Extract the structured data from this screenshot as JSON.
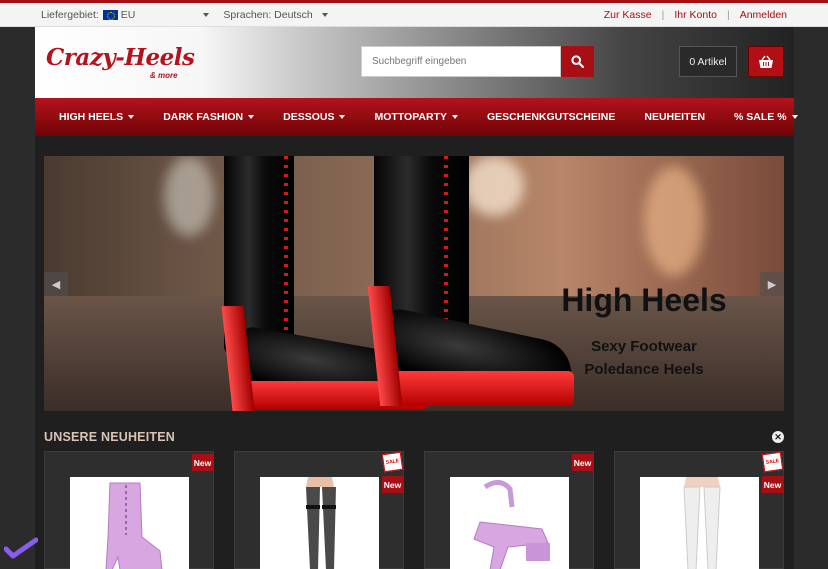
{
  "topbar": {
    "delivery_label": "Liefergebiet:",
    "delivery_value": "EU",
    "language_label": "Sprachen: Deutsch",
    "links": [
      "Zur Kasse",
      "Ihr Konto",
      "Anmelden"
    ]
  },
  "header": {
    "logo_text": "Crazy-Heels",
    "logo_sub": "& more",
    "search_placeholder": "Suchbegriff eingeben",
    "cart_count": "0 Artikel"
  },
  "nav": {
    "items": [
      {
        "label": "HIGH HEELS",
        "dropdown": true
      },
      {
        "label": "DARK FASHION",
        "dropdown": true
      },
      {
        "label": "DESSOUS",
        "dropdown": true
      },
      {
        "label": "MOTTOPARTY",
        "dropdown": true
      },
      {
        "label": "GESCHENKGUTSCHEINE",
        "dropdown": false
      },
      {
        "label": "NEUHEITEN",
        "dropdown": false
      },
      {
        "label": "% SALE %",
        "dropdown": true
      }
    ]
  },
  "slider": {
    "title": "High Heels",
    "subtitle1": "Sexy Footwear",
    "subtitle2": "Poledance Heels"
  },
  "section": {
    "title": "UNSERE NEUHEITEN"
  },
  "products": [
    {
      "badge": "New",
      "sale": false,
      "image": "pink-glitter-lace-up-boot"
    },
    {
      "badge": "New",
      "sale": true,
      "sale_text": "SALE",
      "image": "black-stockings-legs"
    },
    {
      "badge": "New",
      "sale": false,
      "image": "pink-glitter-platform-sandal"
    },
    {
      "badge": "New",
      "sale": true,
      "sale_text": "SALE",
      "image": "white-lace-stockings-legs"
    }
  ],
  "colors": {
    "brand_red": "#a80f14",
    "page_bg": "#2b2b2b",
    "section_title": "#d9c4b6"
  }
}
